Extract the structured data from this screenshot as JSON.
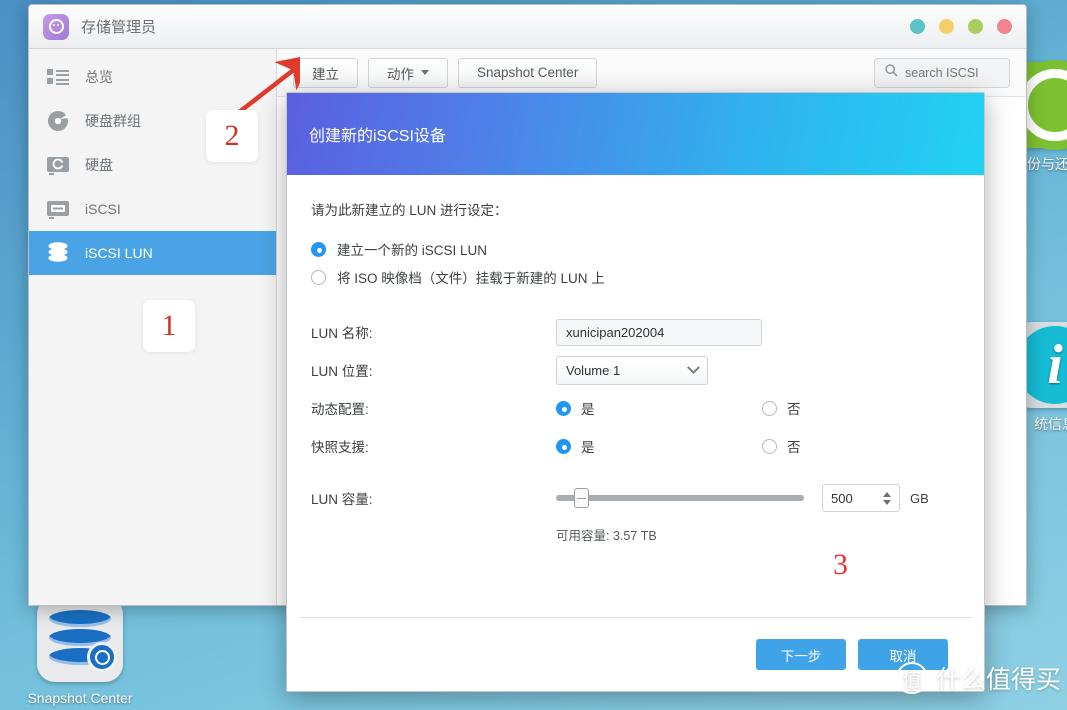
{
  "desktop": {
    "icons": [
      {
        "name": "backup-restore",
        "label": "份与还原"
      },
      {
        "name": "system-info",
        "label": "统信息"
      },
      {
        "name": "snapshot-center",
        "label": "Snapshot Center"
      }
    ]
  },
  "window": {
    "title": "存储管理员",
    "logo_icon": "storage-manager-icon",
    "controls": [
      {
        "name": "minimize",
        "color": "#5cc2c6"
      },
      {
        "name": "restore",
        "color": "#f3ce6a"
      },
      {
        "name": "maximize",
        "color": "#a8cf5e"
      },
      {
        "name": "close",
        "color": "#f0858f"
      }
    ]
  },
  "sidebar": {
    "items": [
      {
        "label": "总览",
        "icon": "overview-icon",
        "active": false
      },
      {
        "label": "硬盘群组",
        "icon": "disk-group-icon",
        "active": false
      },
      {
        "label": "硬盘",
        "icon": "disk-icon",
        "active": false
      },
      {
        "label": "iSCSI",
        "icon": "iscsi-icon",
        "active": false
      },
      {
        "label": "iSCSI LUN",
        "icon": "iscsi-lun-icon",
        "active": true
      }
    ]
  },
  "toolbar": {
    "create_label": "建立",
    "action_label": "动作",
    "snapshot_center_label": "Snapshot Center",
    "search_placeholder": "search ISCSI",
    "search_value": "",
    "search_icon": "search-icon"
  },
  "dialog": {
    "title": "创建新的iSCSI设备",
    "intro": "请为此新建立的 LUN 进行设定：",
    "mode_options": [
      {
        "label": "建立一个新的 iSCSI LUN",
        "selected": true
      },
      {
        "label": "将 ISO 映像档（文件）挂载于新建的 LUN 上",
        "selected": false
      }
    ],
    "fields": {
      "lun_name_label": "LUN 名称:",
      "lun_name_value": "xunicipan202004",
      "lun_location_label": "LUN 位置:",
      "lun_location_value": "Volume 1",
      "thin_provision_label": "动态配置:",
      "thin_provision_yes": "是",
      "thin_provision_no": "否",
      "snapshot_support_label": "快照支援:",
      "snapshot_support_yes": "是",
      "snapshot_support_no": "否",
      "capacity_label": "LUN 容量:",
      "capacity_value": "500",
      "capacity_unit": "GB",
      "capacity_slider_percent": 8,
      "available_label": "可用容量: 3.57 TB"
    },
    "footer": {
      "next_label": "下一步",
      "cancel_label": "取消"
    }
  },
  "annotations": {
    "step1": "1",
    "step2": "2",
    "step3": "3"
  },
  "watermark": {
    "mark": "值",
    "text": "什么值得买"
  },
  "colors": {
    "accent_blue": "#4aa3e5",
    "button_blue": "#3fa3e8",
    "radio_blue": "#2196f3",
    "annotation_red": "#d3302a"
  }
}
